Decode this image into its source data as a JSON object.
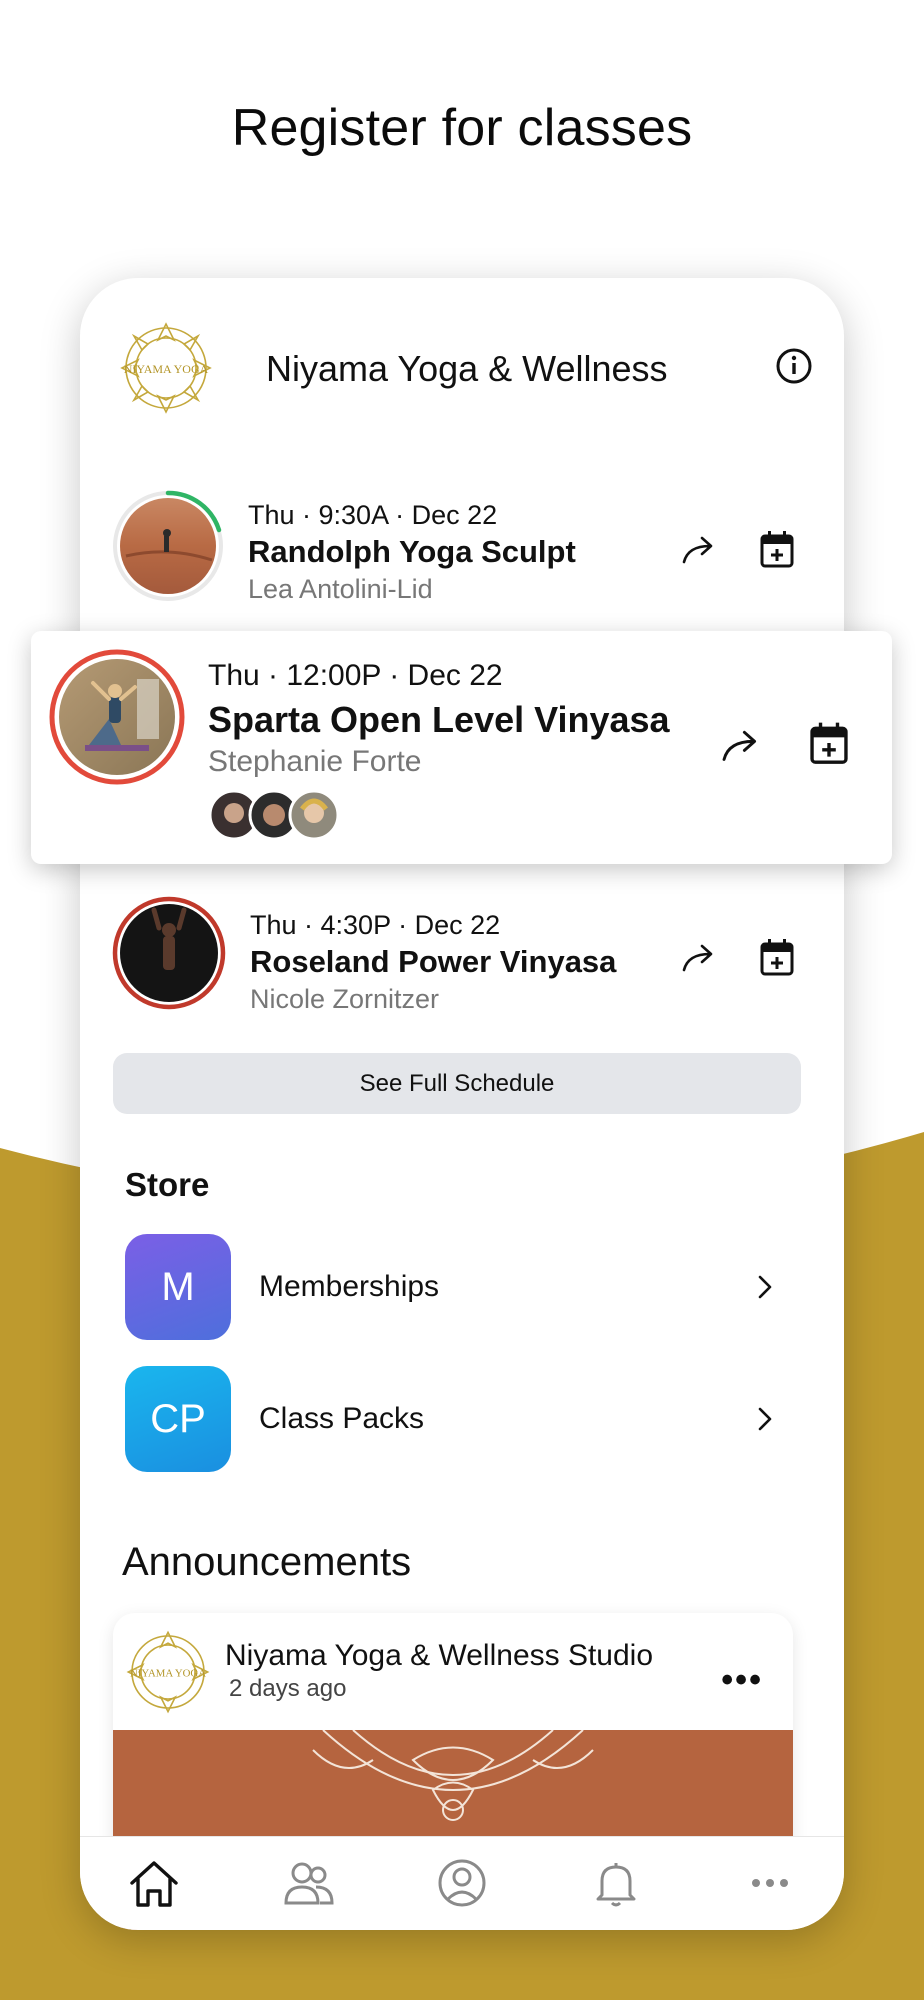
{
  "headline": "Register for classes",
  "colors": {
    "gold": "#be9a2e",
    "accent_green": "#2fb565",
    "accent_red": "#e24a3b",
    "membership_badge": "#6f5de3",
    "classpack_badge": "#1ab0ea"
  },
  "studio": {
    "name": "Niyama Yoga & Wellness",
    "logo_icon": "mandala-logo-icon",
    "info_icon": "info-icon",
    "switch_icon": "swap-arrows-icon"
  },
  "classes": [
    {
      "time": "Thu · 9:30A · Dec 22",
      "title": "Randolph Yoga Sculpt",
      "teacher": "Lea Antolini-Lid",
      "ring_color": "#2fb565",
      "ring_progress": 0.22
    },
    {
      "time": "Thu · 12:00P · Dec 22",
      "title": "Sparta Open Level Vinyasa",
      "teacher": "Stephanie Forte",
      "ring_color": "#e24a3b",
      "ring_progress": 0.95,
      "attendee_count_shown": 3
    },
    {
      "time": "Thu · 4:30P · Dec 22",
      "title": "Roseland Power Vinyasa",
      "teacher": "Nicole Zornitzer",
      "ring_color": "#c0392b",
      "ring_progress": 0.9
    }
  ],
  "schedule_button": "See Full Schedule",
  "store": {
    "label": "Store",
    "items": [
      {
        "badge": "M",
        "label": "Memberships"
      },
      {
        "badge": "CP",
        "label": "Class Packs"
      }
    ]
  },
  "announcements": {
    "title": "Announcements",
    "card": {
      "author": "Niyama Yoga & Wellness Studio",
      "time": "2 days ago",
      "more": "•••"
    }
  },
  "tabbar": [
    "home-icon",
    "community-icon",
    "profile-icon",
    "notifications-icon",
    "more-icon"
  ]
}
